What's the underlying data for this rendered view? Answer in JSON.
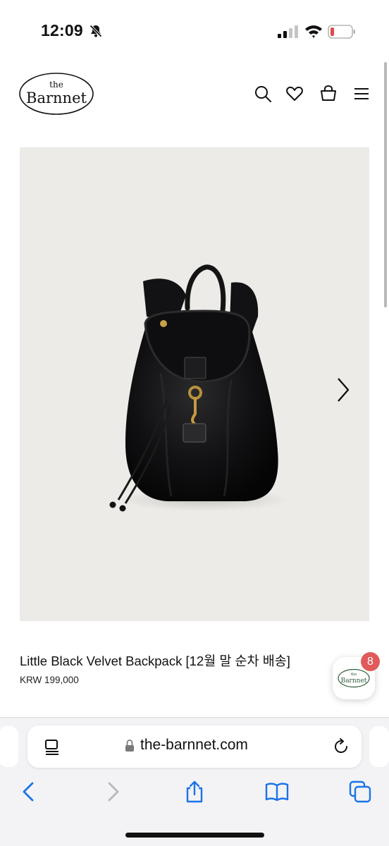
{
  "status_bar": {
    "time": "12:09",
    "icons": [
      "bell-slash-icon",
      "cellular-signal-icon",
      "wifi-icon",
      "battery-low-icon"
    ],
    "battery_color": "#e5484d"
  },
  "header": {
    "logo_top": "the",
    "logo_main": "Barnnet",
    "icons": [
      "search-icon",
      "heart-icon",
      "shopping-bag-icon",
      "hamburger-menu-icon"
    ]
  },
  "product": {
    "image_subject": "Black velvet backpack with leather trim and gold clasp",
    "title": "Little Black Velvet Backpack [12월 말 순차 배송]",
    "price": "KRW 199,000"
  },
  "chat_badge": {
    "logo_top": "the",
    "logo_main": "Barnnet",
    "count": "8",
    "badge_color": "#e05a5a",
    "logo_color": "#2f5d3a"
  },
  "browser": {
    "url": "the-barnnet.com",
    "icons": [
      "reader-mode-icon",
      "lock-icon",
      "reload-icon",
      "back-icon",
      "forward-icon",
      "share-icon",
      "bookmarks-icon",
      "tabs-icon"
    ],
    "accent": "#1a73e8"
  }
}
